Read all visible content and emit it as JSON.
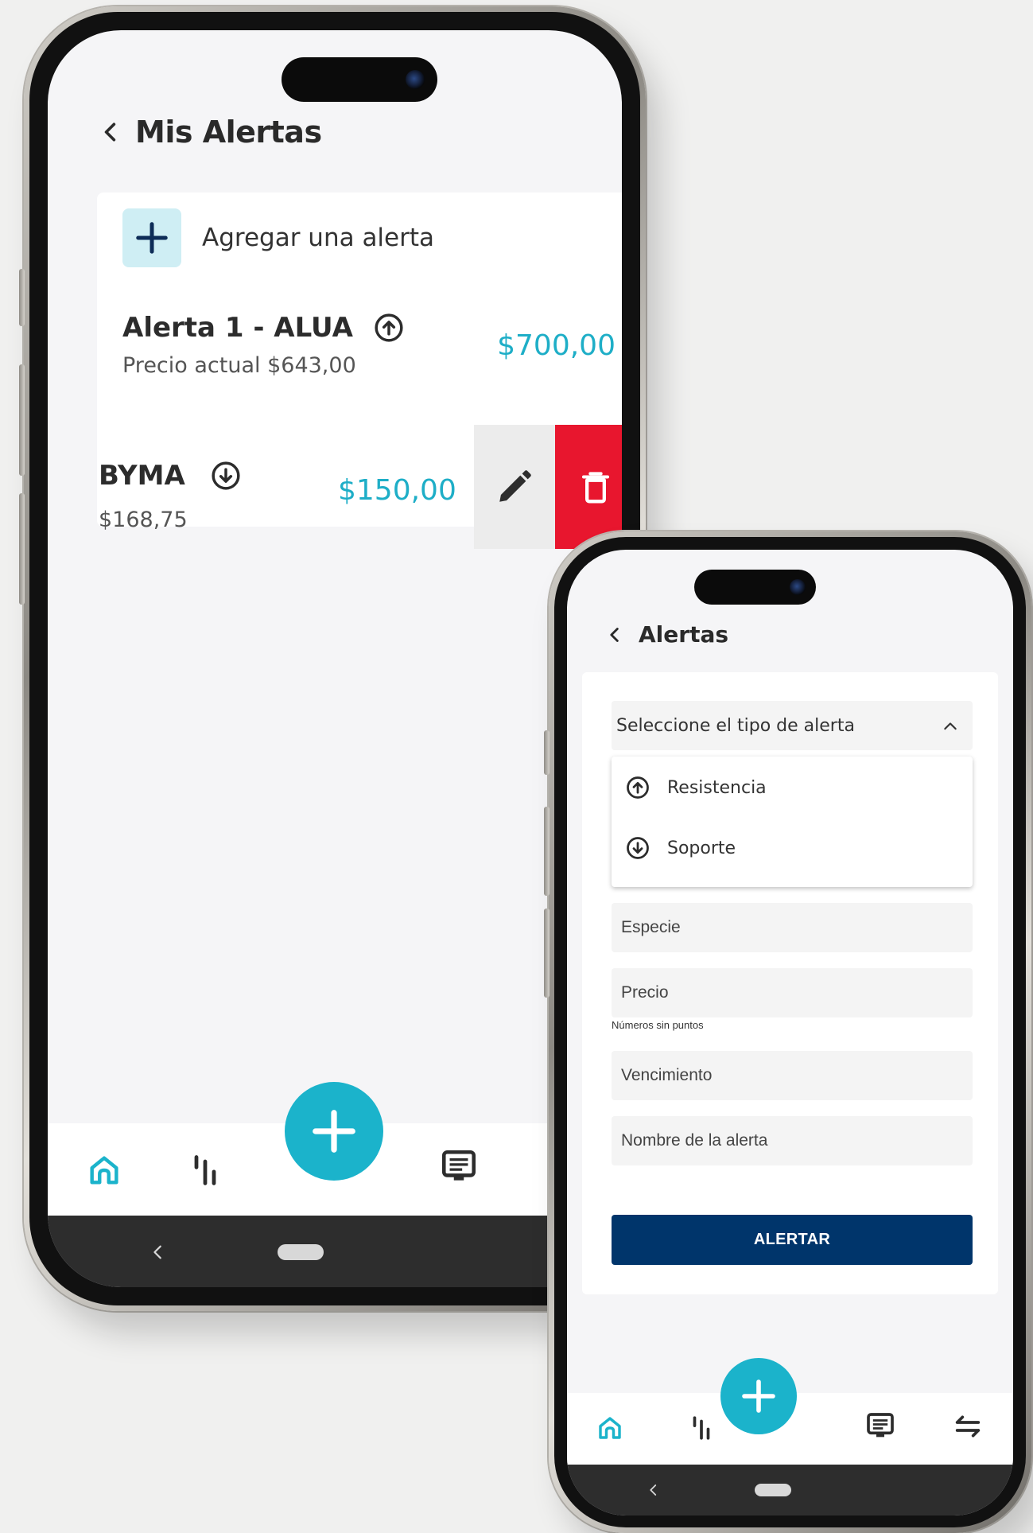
{
  "colors": {
    "accent": "#1bb3cb",
    "price": "#1eaec7",
    "delete": "#e8162e",
    "primary_button": "#00356b",
    "add_button_bg": "#cfeef4"
  },
  "screen1": {
    "header": {
      "title": "Mis Alertas",
      "back_icon": "chevron-left-icon"
    },
    "add_alert": {
      "label": "Agregar una alerta",
      "icon": "plus-icon"
    },
    "alerts": [
      {
        "name": "Alerta 1 -  ALUA",
        "direction_icon": "arrow-up-circle-icon",
        "current_price": "Precio actual $643,00",
        "target_price": "$700,00"
      },
      {
        "name": "BYMA",
        "direction_icon": "arrow-down-circle-icon",
        "current_price": "$168,75",
        "target_price": "$150,00",
        "actions": [
          "pencil-icon",
          "trash-icon"
        ]
      }
    ],
    "nav": {
      "items": [
        "home-icon",
        "chart-icon",
        "fab-plus-icon",
        "terminal-icon"
      ]
    },
    "system_nav": [
      "back-icon",
      "home-pill"
    ]
  },
  "screen2": {
    "header": {
      "title": "Alertas",
      "back_icon": "chevron-left-icon"
    },
    "alert_type_select": {
      "label": "Seleccione el tipo de alerta",
      "options": [
        {
          "label": "Resistencia",
          "icon": "arrow-up-circle-icon"
        },
        {
          "label": "Soporte",
          "icon": "arrow-down-circle-icon"
        }
      ]
    },
    "fields": {
      "especie": "Especie",
      "precio": "Precio",
      "precio_hint": "Números sin puntos",
      "vencimiento": "Vencimiento",
      "nombre": "Nombre de la alerta"
    },
    "submit_label": "ALERTAR",
    "nav": {
      "items": [
        "home-icon",
        "chart-icon",
        "fab-plus-icon",
        "terminal-icon",
        "swap-icon"
      ]
    },
    "system_nav": [
      "back-icon",
      "home-pill"
    ]
  }
}
